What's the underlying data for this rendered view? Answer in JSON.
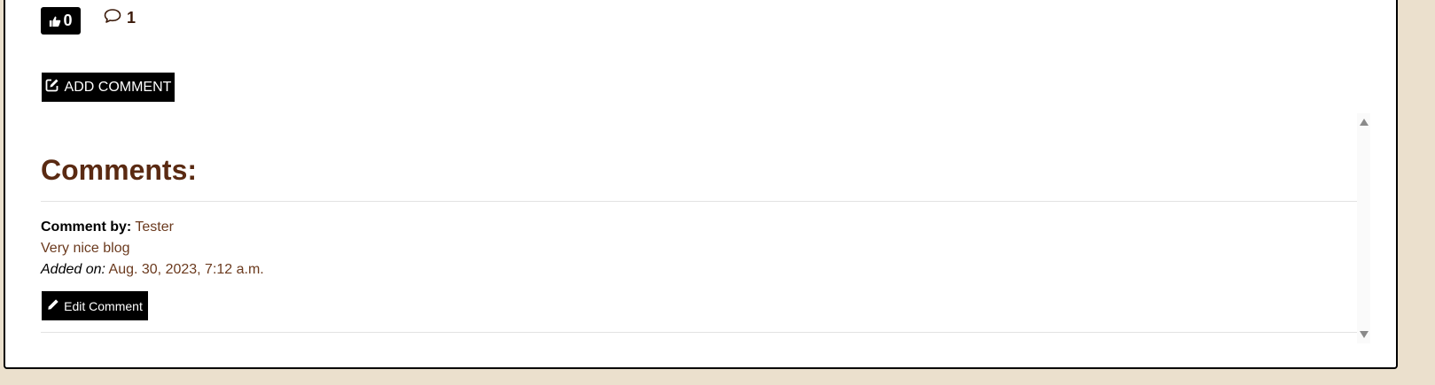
{
  "post": {
    "like_count": "0",
    "comment_count": "1",
    "add_comment_label": "ADD COMMENT"
  },
  "comments_section": {
    "heading": "Comments:",
    "items": [
      {
        "by_label": "Comment by:",
        "author": "Tester",
        "body": "Very nice blog",
        "added_label": "Added on:",
        "added_value": "Aug. 30, 2023, 7:12 a.m.",
        "edit_label": "Edit Comment"
      }
    ]
  },
  "icons": {
    "like": "thumbs-up-icon",
    "comment": "speech-bubble-icon",
    "add": "edit-square-icon",
    "edit": "pencil-icon"
  },
  "colors": {
    "page_background": "#ebe0cd",
    "heading": "#5a2a12",
    "text_accent": "#6b3a1e",
    "button": "#000000"
  }
}
